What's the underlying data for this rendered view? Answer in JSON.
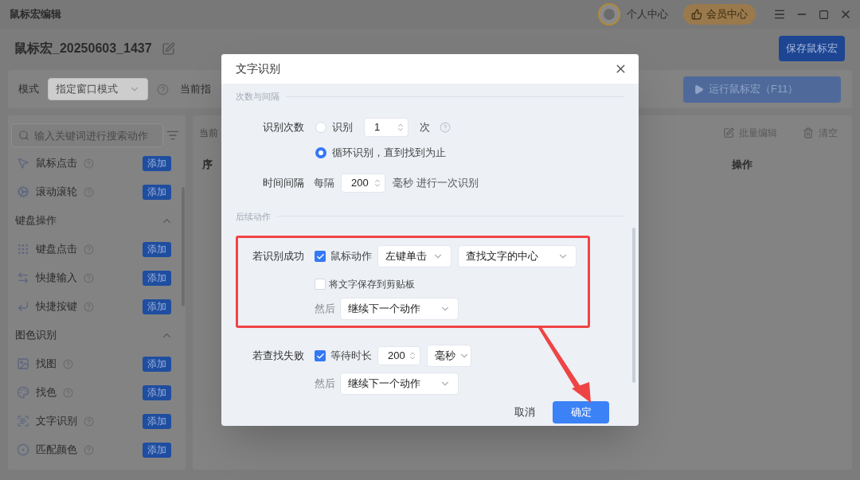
{
  "window": {
    "title": "鼠标宏编辑",
    "user_label": "个人中心",
    "vip_label": "会员中心"
  },
  "macro": {
    "name": "鼠标宏_20250603_1437",
    "save_button": "保存鼠标宏"
  },
  "toolbar": {
    "mode_label": "模式",
    "mode_value": "指定窗口模式",
    "current_label": "当前指",
    "run_button": "运行鼠标宏（F11）"
  },
  "sidebar": {
    "search_placeholder": "输入关键词进行搜索动作",
    "items": [
      {
        "kind": "action",
        "label": "鼠标点击",
        "button": "添加"
      },
      {
        "kind": "action",
        "label": "滚动滚轮",
        "button": "添加"
      },
      {
        "kind": "group",
        "label": "键盘操作",
        "expanded": true
      },
      {
        "kind": "action",
        "label": "键盘点击",
        "button": "添加"
      },
      {
        "kind": "action",
        "label": "快捷输入",
        "button": "添加"
      },
      {
        "kind": "action",
        "label": "快捷按键",
        "button": "添加"
      },
      {
        "kind": "group",
        "label": "图色识别",
        "expanded": true
      },
      {
        "kind": "action",
        "label": "找图",
        "button": "添加"
      },
      {
        "kind": "action",
        "label": "找色",
        "button": "添加"
      },
      {
        "kind": "action",
        "label": "文字识别",
        "button": "添加"
      },
      {
        "kind": "action",
        "label": "匹配颜色",
        "button": "添加"
      }
    ]
  },
  "list": {
    "title": "当前",
    "batch_edit": "批量编辑",
    "clear": "清空",
    "columns": [
      "序",
      "操作"
    ]
  },
  "dialog": {
    "title": "文字识别",
    "section_1": "次数与间隔",
    "count": {
      "label": "识别次数",
      "options": [
        {
          "kind": "count",
          "label": "识别",
          "selected": false,
          "value": "1",
          "unit": "次"
        },
        {
          "kind": "loop",
          "label": "循环识别，直到找到为止",
          "selected": true
        }
      ]
    },
    "interval": {
      "label": "时间间隔",
      "prefix": "每隔",
      "value": "200",
      "suffix": "毫秒 进行一次识别"
    },
    "section_2": "后续动作",
    "on_success": {
      "label": "若识别成功",
      "mouse_action": {
        "label": "鼠标动作",
        "checked": true,
        "button": "左键单击",
        "position": "查找文字的中心"
      },
      "save_clipboard": {
        "label": "将文字保存到剪贴板",
        "checked": false
      },
      "then_label": "然后",
      "then_value": "继续下一个动作"
    },
    "on_fail": {
      "label": "若查找失败",
      "wait": {
        "label": "等待时长",
        "checked": true,
        "value": "200",
        "unit": "毫秒"
      },
      "then_label": "然后",
      "then_value": "继续下一个动作"
    },
    "cancel": "取消",
    "confirm": "确定"
  }
}
